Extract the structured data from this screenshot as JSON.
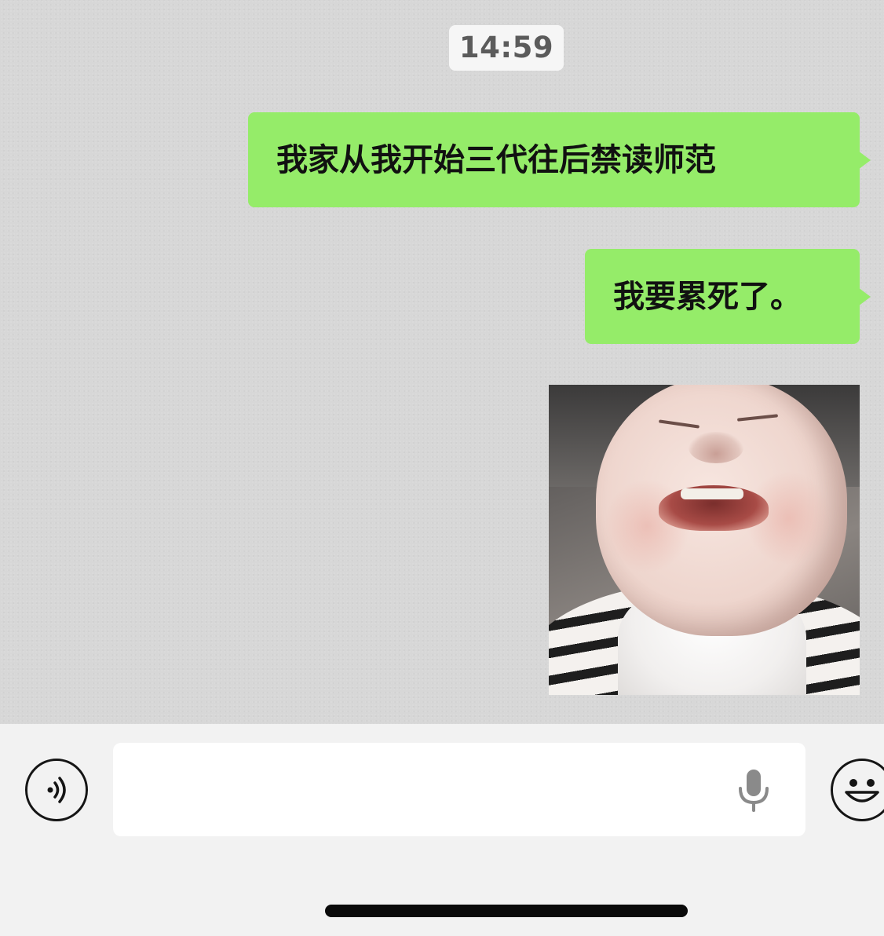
{
  "chat": {
    "timestamp": "14:59",
    "messages": [
      {
        "type": "text",
        "side": "right",
        "text": "我家从我开始三代往后禁读师范"
      },
      {
        "type": "text",
        "side": "right",
        "text": "我要累死了。"
      },
      {
        "type": "image",
        "side": "right",
        "icon": "crying-baby-sticker"
      }
    ]
  },
  "input_bar": {
    "voice_icon": "voice-mode-icon",
    "text_value": "",
    "text_placeholder": "",
    "mic_icon": "microphone-icon",
    "emoji_icon": "emoji-icon"
  },
  "colors": {
    "chat_background": "#d7d7d7",
    "sent_bubble": "#95ec69",
    "input_bar_background": "#f2f2f2",
    "timestamp_background": "#f6f6f6"
  }
}
